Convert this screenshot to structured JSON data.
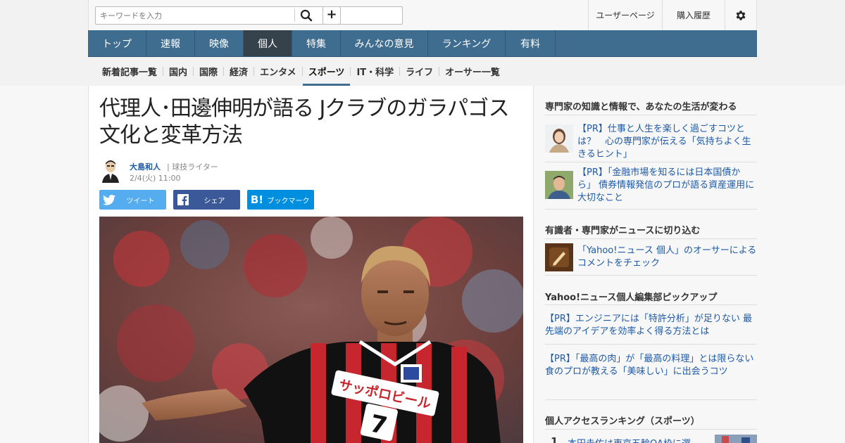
{
  "header": {
    "search_placeholder": "キーワードを入力",
    "plus_label": "+",
    "user_page": "ユーザーページ",
    "purchase_history": "購入履歴"
  },
  "main_nav": {
    "items": [
      {
        "label": "トップ"
      },
      {
        "label": "速報"
      },
      {
        "label": "映像"
      },
      {
        "label": "個人"
      },
      {
        "label": "特集"
      },
      {
        "label": "みんなの意見"
      },
      {
        "label": "ランキング"
      },
      {
        "label": "有料"
      }
    ],
    "active": "個人"
  },
  "sub_nav": {
    "items": [
      {
        "label": "新着記事一覧"
      },
      {
        "label": "国内"
      },
      {
        "label": "国際"
      },
      {
        "label": "経済"
      },
      {
        "label": "エンタメ"
      },
      {
        "label": "スポーツ"
      },
      {
        "label": "IT・科学"
      },
      {
        "label": "ライフ"
      },
      {
        "label": "オーサー一覧"
      }
    ],
    "active": "スポーツ"
  },
  "article": {
    "title": "代理人･田邊伸明が語る Jクラブのガラパゴス文化と変革方法",
    "author": "大島和人",
    "author_role": "| 球技ライター",
    "date": "2/4(火) 11:00",
    "share": {
      "tweet": "ツイート",
      "facebook": "シェア",
      "bookmark": "ブックマーク",
      "bookmark_icon": "B!"
    },
    "photo": {
      "jersey_text": "サッポロビール",
      "number": "7"
    }
  },
  "sidebar": {
    "section1_title": "専門家の知識と情報で、あなたの生活が変わる",
    "section1_items": [
      {
        "text": "【PR】仕事と人生を楽しく過ごすコツとは？　心の専門家が伝える「気持ちよく生きるヒント」"
      },
      {
        "text": "【PR】「金融市場を知るには日本国債から」 債券情報発信のプロが語る資産運用に大切なこと"
      }
    ],
    "section2_title": "有識者・専門家がニュースに切り込む",
    "section2_item": "「Yahoo!ニュース 個人」のオーサーによるコメントをチェック",
    "section3_title": "Yahoo!ニュース個人編集部ピックアップ",
    "section3_items": [
      {
        "text": "【PR】エンジニアには「特許分析」が足りない 最先端のアイデアを効率よく得る方法とは"
      },
      {
        "text": "【PR】「最高の肉」が「最高の料理」とは限らない　食のプロが教える「美味しい」に出会うコツ"
      }
    ],
    "section4_title": "個人アクセスランキング（スポーツ）",
    "ranking": [
      {
        "rank": "1",
        "text": "本田圭佑は東京五輪OA枠に選"
      }
    ]
  },
  "colors": {
    "nav_bg": "#3f6d90",
    "nav_active": "#36424b",
    "link": "#1d5aa8",
    "twitter": "#55acee",
    "facebook": "#3b5998",
    "hatena": "#008fde"
  }
}
